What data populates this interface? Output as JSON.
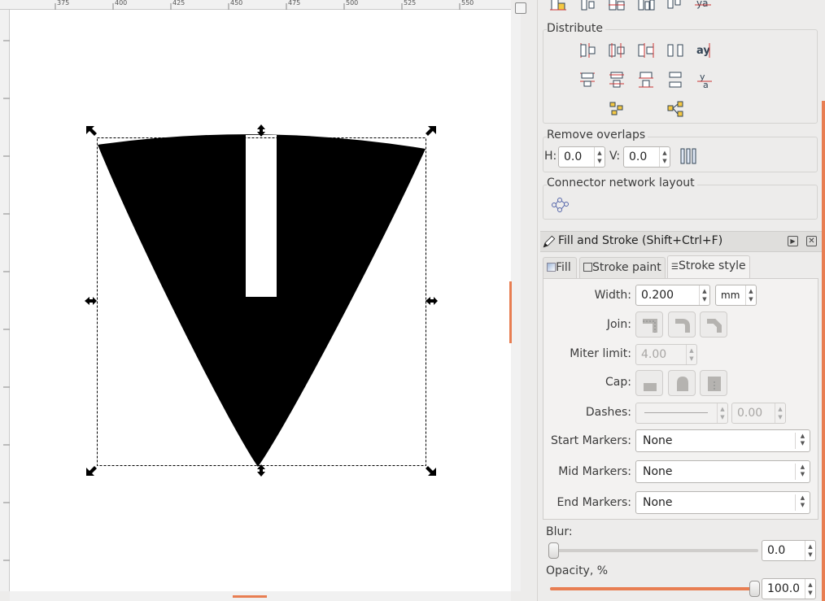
{
  "ruler": {
    "labels": [
      "375",
      "400",
      "425",
      "450",
      "475",
      "500",
      "525",
      "550"
    ]
  },
  "align_panel": {
    "distribute_title": "Distribute",
    "remove_overlaps": {
      "title": "Remove overlaps",
      "h_label": "H:",
      "h_value": "0.0",
      "v_label": "V:",
      "v_value": "0.0"
    },
    "connector_title": "Connector network layout"
  },
  "fill_stroke": {
    "title": "Fill and Stroke (Shift+Ctrl+F)",
    "tabs": [
      "Fill",
      "Stroke paint",
      "Stroke style"
    ],
    "active_tab": "Stroke style",
    "width_label": "Width:",
    "width_value": "0.200",
    "unit": "mm",
    "join_label": "Join:",
    "miter_label": "Miter limit:",
    "miter_value": "4.00",
    "cap_label": "Cap:",
    "dashes_label": "Dashes:",
    "dash_offset": "0.00",
    "start_markers_label": "Start Markers:",
    "start_markers_value": "None",
    "mid_markers_label": "Mid Markers:",
    "mid_markers_value": "None",
    "end_markers_label": "End Markers:",
    "end_markers_value": "None",
    "blur_label": "Blur:",
    "blur_value": "0.0",
    "blur_level": 0.0,
    "opacity_label": "Opacity, %",
    "opacity_value": "100.0",
    "opacity_level": 1.0
  },
  "colors": {
    "accent": "#e87e52",
    "shape_fill": "#000000",
    "canvas": "#ffffff"
  }
}
